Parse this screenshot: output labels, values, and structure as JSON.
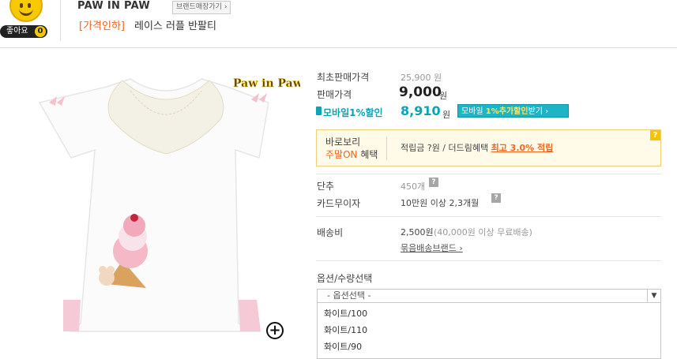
{
  "header": {
    "like_label": "좋아요",
    "like_count": "0",
    "brand_name": "PAW IN PAW",
    "brand_shop_button": "브랜드매장가기 ›",
    "title_tag": "[가격인하]",
    "title": "레이스 러플 반팔티"
  },
  "product_image": {
    "logo_text": "Paw in Paw",
    "zoom_icon": "plus-circle-icon"
  },
  "price": {
    "original_label": "최초판매가격",
    "original_value": "25,900 원",
    "sale_label": "판매가격",
    "sale_value": "9,000",
    "sale_unit": "원",
    "mobile_label": "모바일1%할인",
    "mobile_value": "8,910",
    "mobile_unit": "원",
    "mobile_button_pre": "모바일 ",
    "mobile_button_hl": "1%추가할인",
    "mobile_button_post": "받기 ›"
  },
  "benefit": {
    "name": "바로보리",
    "sub_hl": "주말ON",
    "sub": " 혜택",
    "text": "적립금 ?원 / 더드림혜택 ",
    "link": "최고 3.0% 적립",
    "help": "?"
  },
  "info": {
    "unit_label": "단추",
    "unit_value": "450개",
    "card_label": "카드무이자",
    "card_value": "10만원 이상 2,3개월",
    "ship_label": "배송비",
    "ship_value": "2,500원",
    "ship_note": "(40,000원 이상 무료배송)",
    "bundle_link": "묶음배송브랜드 ›",
    "help": "?"
  },
  "options": {
    "label": "옵션/수량선택",
    "selected": "- 옵션선택 -",
    "items": [
      "화이트/100",
      "화이트/110",
      "화이트/90"
    ]
  },
  "colors": {
    "accent_orange": "#f26522",
    "mobile_teal": "#0aa5b5",
    "like_yellow": "#f7c900"
  }
}
